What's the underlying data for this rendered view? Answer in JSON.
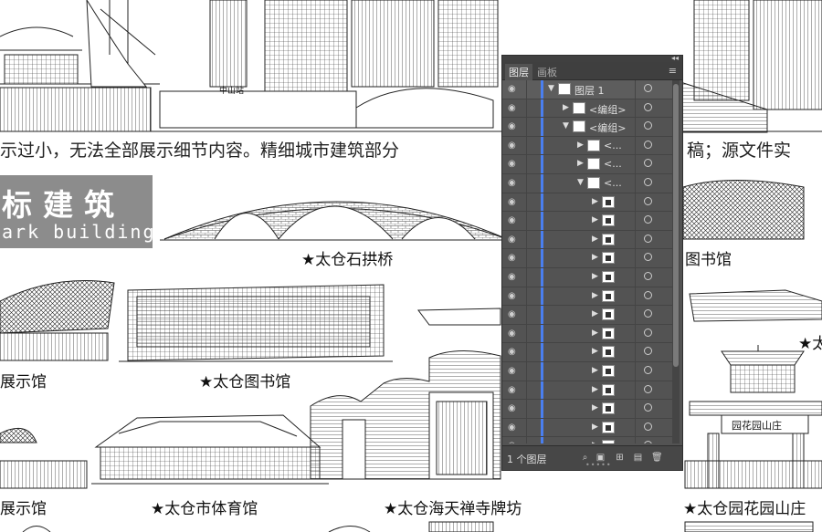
{
  "notice": "示过小，无法全部展示细节内容。精细城市建筑部分",
  "notice_right": "稿；源文件实",
  "title_main": "标建筑",
  "title_sub": "ark building",
  "building_labels": {
    "bridge": "★太仓石拱桥",
    "library_right": "图书馆",
    "exhibit": "展示馆",
    "library": "★太仓图书馆",
    "star_right": "★太",
    "exhibit2": "展示馆",
    "stadium": "★太仓市体育馆",
    "temple": "★太仓海天禅寺牌坊",
    "garden": "★太仓园花园山庄",
    "sign_left": "中山站",
    "arch_plaque": "园花园山庄"
  },
  "panel": {
    "tab_layers": "图层",
    "tab_artboards": "画板",
    "rows": [
      {
        "indent": 0,
        "expanded": true,
        "name": "图层 1",
        "thumb": "layer"
      },
      {
        "indent": 1,
        "expanded": false,
        "name": "<编组>",
        "thumb": "group"
      },
      {
        "indent": 1,
        "expanded": true,
        "name": "<编组>",
        "thumb": "group"
      },
      {
        "indent": 2,
        "expanded": false,
        "name": "<...",
        "thumb": "group"
      },
      {
        "indent": 2,
        "expanded": false,
        "name": "<...",
        "thumb": "group"
      },
      {
        "indent": 2,
        "expanded": true,
        "name": "<...",
        "thumb": "group"
      },
      {
        "indent": 3,
        "expanded": false,
        "name": "",
        "thumb": "obj"
      },
      {
        "indent": 3,
        "expanded": false,
        "name": "",
        "thumb": "obj"
      },
      {
        "indent": 3,
        "expanded": false,
        "name": "",
        "thumb": "obj"
      },
      {
        "indent": 3,
        "expanded": false,
        "name": "",
        "thumb": "obj"
      },
      {
        "indent": 3,
        "expanded": false,
        "name": "",
        "thumb": "obj"
      },
      {
        "indent": 3,
        "expanded": false,
        "name": "",
        "thumb": "obj"
      },
      {
        "indent": 3,
        "expanded": false,
        "name": "",
        "thumb": "obj"
      },
      {
        "indent": 3,
        "expanded": false,
        "name": "",
        "thumb": "obj"
      },
      {
        "indent": 3,
        "expanded": false,
        "name": "",
        "thumb": "obj"
      },
      {
        "indent": 3,
        "expanded": false,
        "name": "",
        "thumb": "obj"
      },
      {
        "indent": 3,
        "expanded": false,
        "name": "",
        "thumb": "obj"
      },
      {
        "indent": 3,
        "expanded": false,
        "name": "",
        "thumb": "obj"
      },
      {
        "indent": 3,
        "expanded": false,
        "name": "",
        "thumb": "obj"
      },
      {
        "indent": 3,
        "expanded": false,
        "name": "",
        "thumb": "obj"
      }
    ],
    "layer_count": "1 个图层",
    "icons": [
      "locate-object-icon",
      "make-clipping-mask-icon",
      "new-sublayer-icon",
      "new-layer-icon",
      "delete-icon"
    ]
  },
  "colors": {
    "panel_bg": "#535353",
    "highlight_stripe": "#4a7ff0",
    "title_box": "#8c8c8c"
  }
}
